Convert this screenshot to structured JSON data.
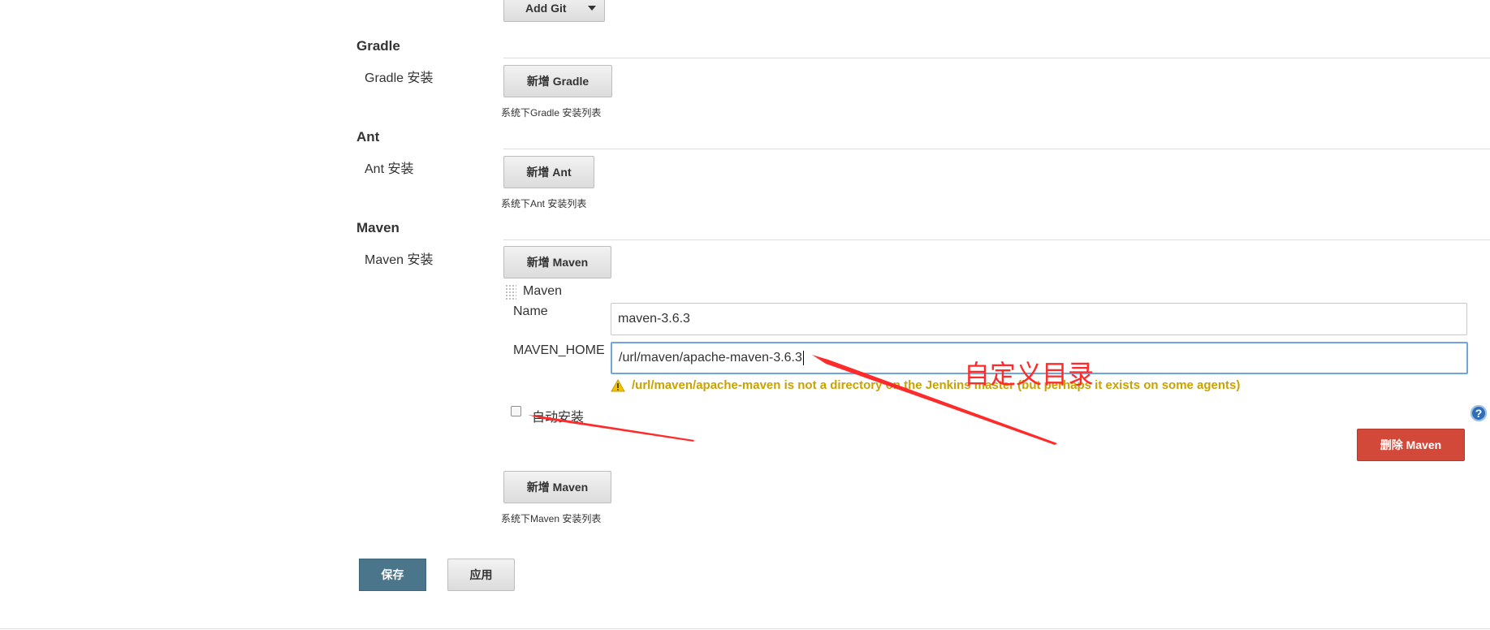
{
  "top": {
    "add_git_label": "Add Git"
  },
  "gradle": {
    "title": "Gradle",
    "field_label": "Gradle 安装",
    "add_label": "新增 Gradle",
    "description": "系统下Gradle 安装列表"
  },
  "ant": {
    "title": "Ant",
    "field_label": "Ant 安装",
    "add_label": "新增 Ant",
    "description": "系统下Ant 安装列表"
  },
  "maven": {
    "title": "Maven",
    "field_label": "Maven 安装",
    "add_label": "新增 Maven",
    "item_title": "Maven",
    "name_label": "Name",
    "name_value": "maven-3.6.3",
    "home_label": "MAVEN_HOME",
    "home_value": "/url/maven/apache-maven-3.6.3",
    "warning": "/url/maven/apache-maven is not a directory on the Jenkins master (but perhaps it exists on some agents)",
    "auto_install_label": "自动安装",
    "auto_install_checked": false,
    "delete_label": "删除 Maven",
    "add_label_bottom": "新增 Maven",
    "description": "系统下Maven 安装列表"
  },
  "footer": {
    "save_label": "保存",
    "apply_label": "应用"
  },
  "annotation": {
    "text": "自定义目录",
    "color": "#ff2a2a"
  },
  "colors": {
    "warning": "#c8a200",
    "danger": "#d24939",
    "primary": "#4b758b"
  }
}
